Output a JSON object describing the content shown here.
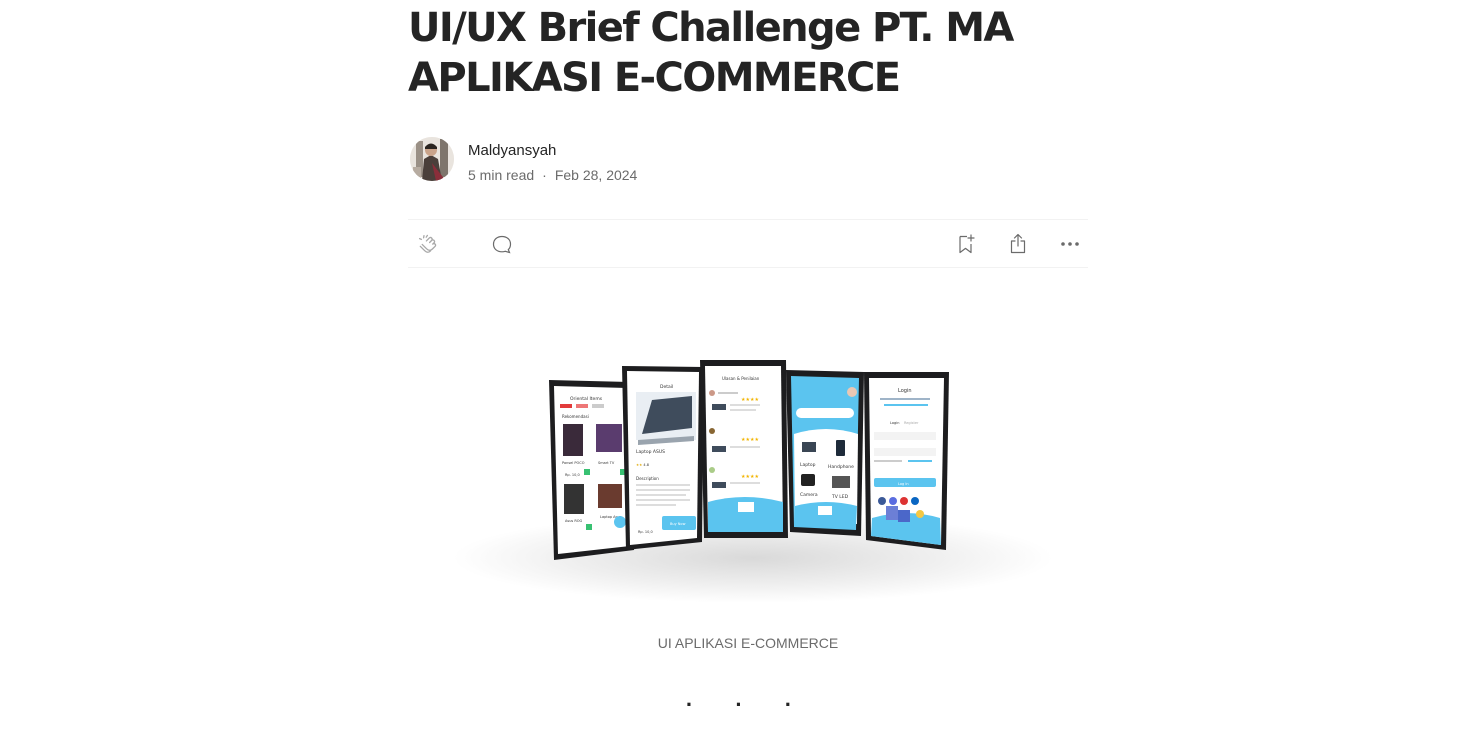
{
  "article": {
    "title": "UI/UX Brief Challenge PT. MA APLIKASI E-COMMERCE",
    "author": "Maldyansyah",
    "read_time": "5 min read",
    "separator": "·",
    "date": "Feb 28, 2024",
    "image_caption": "UI APLIKASI E-COMMERCE",
    "section_break": "· · ·"
  },
  "actions": {
    "clap": "clap-icon",
    "comment": "comment-icon",
    "save": "bookmark-add-icon",
    "share": "share-icon",
    "more": "more-icon"
  },
  "mockups": {
    "screen_1": {
      "title": "Oriental Items",
      "section": "Rekomendasi",
      "items": [
        "Ponsel POCO",
        "Smart TV",
        "Asus ROG",
        "Laptop Asus"
      ],
      "price": "Rp. 10,0"
    },
    "screen_2": {
      "title": "Detail",
      "product": "Laptop ASUS",
      "rating": "4.8",
      "section": "Description",
      "price": "Rp. 10,0",
      "buy_label": "Buy Now"
    },
    "screen_3": {
      "title": "Ulasan & Penilaian"
    },
    "screen_4": {
      "categories": [
        "Laptop",
        "Handphone",
        "Camera",
        "TV LED"
      ]
    },
    "screen_5": {
      "title": "Login",
      "tab_login": "Login",
      "tab_register": "Register",
      "button": "Log In"
    }
  },
  "colors": {
    "accent": "#5bc4ef",
    "text": "#242424",
    "muted": "#6b6b6b"
  }
}
